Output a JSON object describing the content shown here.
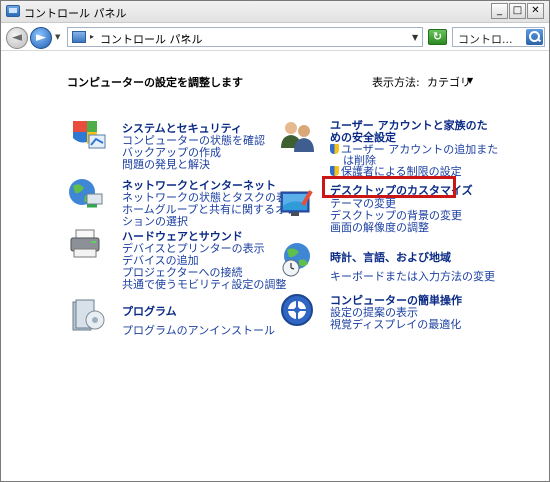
{
  "window": {
    "title": "コントロール パネル",
    "controls": {
      "minimize": "_",
      "maximize": "□",
      "close": "✕"
    }
  },
  "addressbar": {
    "path_label": "コントロール パネル",
    "search_placeholder": "コントロ...",
    "icons": {
      "back": "back-arrow-icon",
      "forward": "forward-arrow-icon",
      "refresh": "refresh-icon",
      "search": "search-icon"
    }
  },
  "content": {
    "heading": "コンピューターの設定を調整します",
    "view_by_label": "表示方法:",
    "view_by_value": "カテゴリ"
  },
  "left_categories": [
    {
      "title": "システムとセキュリティ",
      "icon": "system-security-icon",
      "links": [
        "コンピューターの状態を確認",
        "バックアップの作成",
        "問題の発見と解決"
      ]
    },
    {
      "title": "ネットワークとインターネット",
      "icon": "network-internet-icon",
      "links": [
        "ネットワークの状態とタスクの表示",
        "ホームグループと共有に関するオプ",
        "ションの選択"
      ]
    },
    {
      "title": "ハードウェアとサウンド",
      "icon": "hardware-sound-icon",
      "links": [
        "デバイスとプリンターの表示",
        "デバイスの追加",
        "プロジェクターへの接続",
        "共通で使うモビリティ設定の調整"
      ]
    },
    {
      "title": "プログラム",
      "icon": "programs-icon",
      "links": [
        "プログラムのアンインストール"
      ]
    }
  ],
  "right_categories": [
    {
      "title_lines": [
        "ユーザー アカウントと家族のた",
        "めの安全設定"
      ],
      "icon": "user-accounts-icon",
      "links": [
        "ユーザー アカウントの追加また",
        "は削除",
        "保護者による制限の設定"
      ]
    },
    {
      "title": "デスクトップのカスタマイズ",
      "icon": "desktop-personalization-icon",
      "links": [
        "テーマの変更",
        "デスクトップの背景の変更",
        "画面の解像度の調整"
      ]
    },
    {
      "title": "時計、言語、および地域",
      "icon": "clock-region-icon",
      "links": [
        "キーボードまたは入力方法の変更"
      ]
    },
    {
      "title": "コンピューターの簡単操作",
      "icon": "ease-of-access-icon",
      "links": [
        "設定の提案の表示",
        "視覚ディスプレイの最適化"
      ]
    }
  ],
  "colors": {
    "highlight": "#cc1515",
    "title": "#0a2a85",
    "link": "#1b3fa1"
  }
}
